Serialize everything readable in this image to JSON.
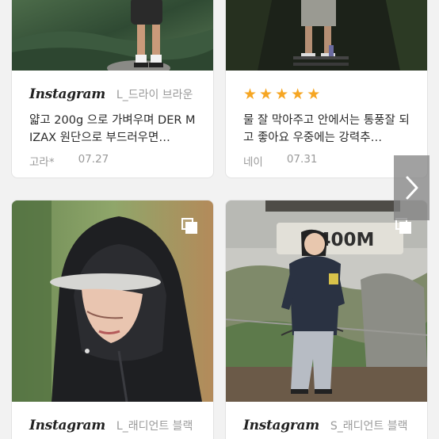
{
  "cards": [
    {
      "source": "Instagram",
      "variant": "L_드라이 브라운",
      "review": "얇고 200g 으로 가벼우며 DER MIZAX 원단으로 부드러우면…",
      "author": "고라*",
      "date": "07.27"
    },
    {
      "rating": 5,
      "stars": [
        "★",
        "★",
        "★",
        "★",
        "★"
      ],
      "review": "물 잘 막아주고 안에서는 통풍잘 되고 좋아요 우중에는 강력추…",
      "author": "네이",
      "date": "07.31"
    },
    {
      "source": "Instagram",
      "variant": "L_래디언트 블랙"
    },
    {
      "source": "Instagram",
      "variant": "S_래디언트 블랙",
      "photo_sign": "2400M"
    }
  ],
  "icons": {
    "multi_photo": "multi-photo-icon",
    "next": "chevron-right-icon"
  }
}
